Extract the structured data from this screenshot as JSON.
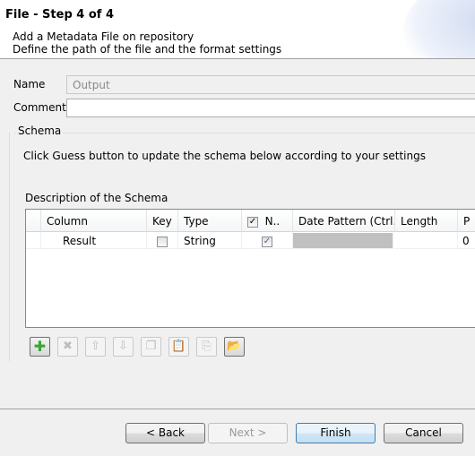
{
  "header": {
    "title": "File - Step 4 of 4",
    "subtitle1": "Add a Metadata File on repository",
    "subtitle2": "Define the path of the file and the format settings"
  },
  "form": {
    "name_label": "Name",
    "name_value": "Output",
    "comment_label": "Comment",
    "comment_value": ""
  },
  "schema": {
    "group_label": "Schema",
    "hint": "Click Guess button to update the schema below according to your settings",
    "description_label": "Description of the Schema",
    "columns": [
      "Column",
      "Key",
      "Type",
      "N..",
      "Date Pattern (Ctrl...",
      "Length",
      "P"
    ],
    "rows": [
      {
        "column": "Result",
        "key": false,
        "type": "String",
        "nullable": true,
        "date_pattern": "",
        "length": "",
        "p": "0"
      }
    ],
    "toolbar": [
      "add-icon",
      "delete-icon",
      "move-up-icon",
      "move-down-icon",
      "copy-icon",
      "paste-icon",
      "import-icon",
      "export-icon"
    ]
  },
  "buttons": {
    "back": "< Back",
    "next": "Next >",
    "finish": "Finish",
    "cancel": "Cancel"
  }
}
